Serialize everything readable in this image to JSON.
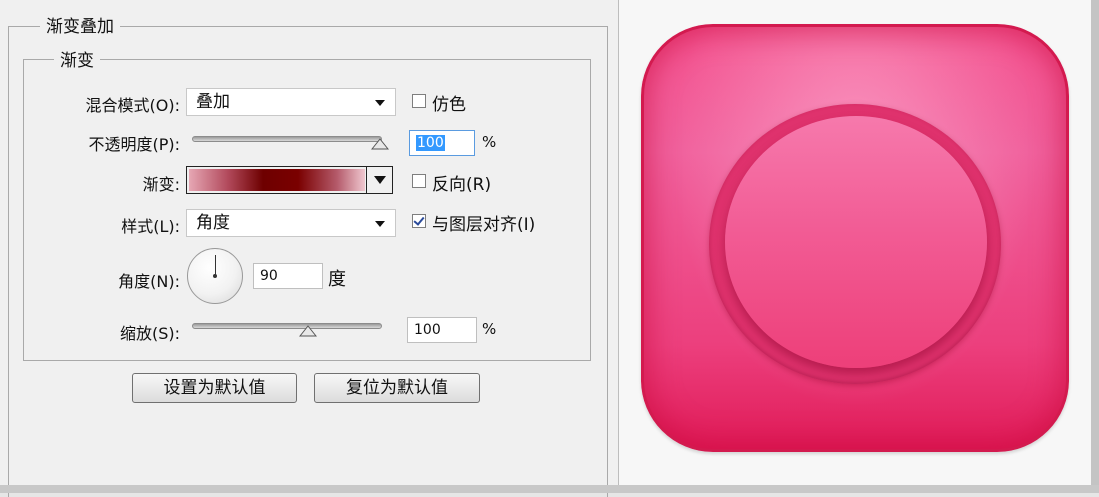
{
  "panel": {
    "title": "渐变叠加",
    "section": "渐变",
    "blend_mode": {
      "label": "混合模式(O):",
      "value": "叠加"
    },
    "dither": {
      "label": "仿色",
      "checked": false
    },
    "opacity": {
      "label": "不透明度(P):",
      "value": "100",
      "unit": "%",
      "fraction": 1.0
    },
    "gradient": {
      "label": "渐变:"
    },
    "reverse": {
      "label": "反向(R)",
      "checked": false
    },
    "style": {
      "label": "样式(L):",
      "value": "角度"
    },
    "align_with_layer": {
      "label": "与图层对齐(I)",
      "checked": true
    },
    "angle": {
      "label": "角度(N):",
      "value": "90",
      "unit": "度"
    },
    "scale": {
      "label": "缩放(S):",
      "value": "100",
      "unit": "%",
      "fraction": 0.6
    },
    "buttons": {
      "make_default": "设置为默认值",
      "reset_default": "复位为默认值"
    }
  },
  "preview": {
    "colors": {
      "outer": "#e01a57",
      "inner": "#f25c95",
      "highlight": "#f679ac"
    }
  }
}
